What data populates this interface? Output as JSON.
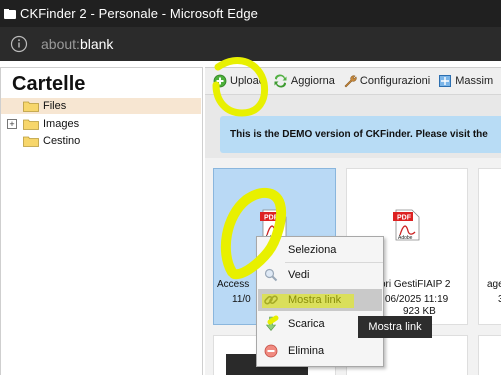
{
  "window": {
    "title": "CKFinder 2 - Personale - Microsoft Edge"
  },
  "address": {
    "prefix": "about:",
    "value": "blank"
  },
  "sidebar": {
    "title": "Cartelle",
    "folders": [
      {
        "label": "Files",
        "selected": true
      },
      {
        "label": "Images",
        "expandable": true
      },
      {
        "label": "Cestino"
      }
    ]
  },
  "toolbar": {
    "upload": "Upload",
    "refresh": "Aggiorna",
    "settings": "Configurazioni",
    "maximize": "Massim"
  },
  "demo_notice": "This is the DEMO version of CKFinder. Please visit the",
  "files": [
    {
      "name": "Access",
      "date": "11/0",
      "selected": true
    },
    {
      "name": "sori GestiFIAIP 2",
      "date": "06/2025 11:19",
      "size": "923 KB"
    },
    {
      "name": "age",
      "date": "3"
    }
  ],
  "file_icon_text": {
    "pdf": "PDF",
    "adobe": "Adobe"
  },
  "context_menu": {
    "items": [
      {
        "label": "Seleziona",
        "icon": "none"
      },
      {
        "label": "Vedi",
        "icon": "magnifier-icon"
      },
      {
        "label": "Mostra link",
        "icon": "link-icon",
        "highlighted": true
      },
      {
        "label": "Scarica",
        "icon": "download-arrow-icon"
      },
      {
        "label": "Elimina",
        "icon": "delete-icon"
      }
    ]
  },
  "tooltip": "Mostra link",
  "colors": {
    "annotation": "#e8f000",
    "selected_folder": "#f7e6d2",
    "demo_bg": "#b8dcf5",
    "selected_tile": "#b9d9f5"
  }
}
